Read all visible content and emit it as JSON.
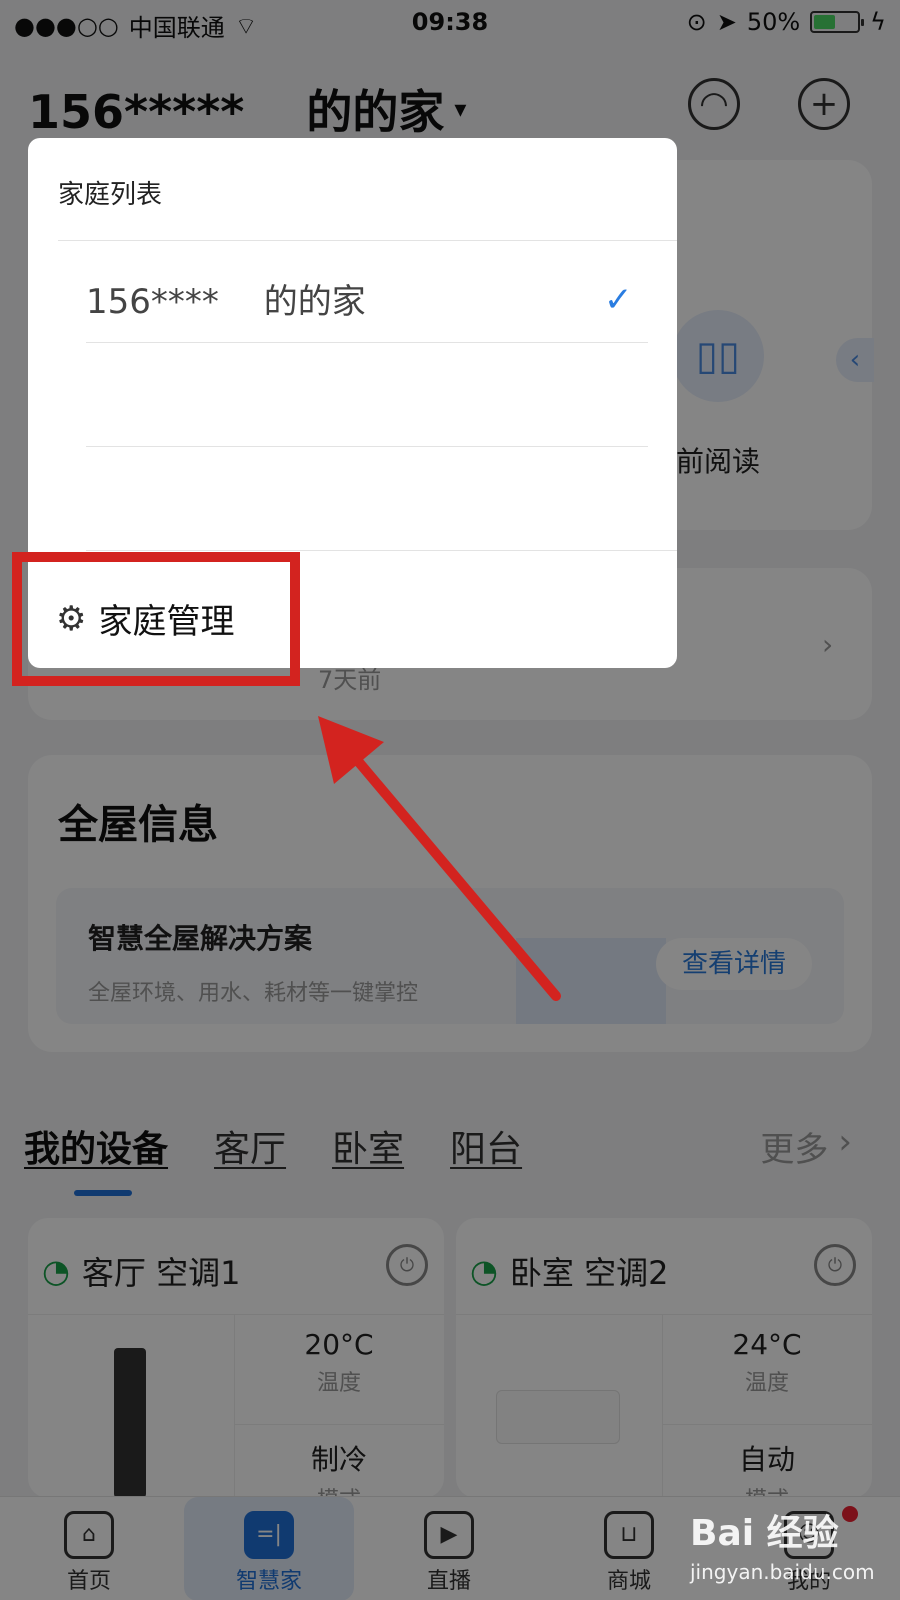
{
  "status_bar": {
    "signal": "●●●○○",
    "carrier": "中国联通",
    "time": "09:38",
    "battery": "50%"
  },
  "header": {
    "home_title": "156*****　 的的家",
    "caret": "▾"
  },
  "background": {
    "read_label": "前阅读",
    "message_time": "7天前",
    "info": {
      "title": "全屋信息",
      "solution_title": "智慧全屋解决方案",
      "solution_sub": "全屋环境、用水、耗材等一键掌控",
      "solution_button": "查看详情"
    },
    "devices_tabs": [
      "我的设备",
      "客厅",
      "卧室",
      "阳台"
    ],
    "more": "更多",
    "devices": [
      {
        "name": "客厅 空调1",
        "temp": "20°C",
        "temp_label": "温度",
        "mode": "制冷",
        "mode_label": "模式"
      },
      {
        "name": "卧室 空调2",
        "temp": "24°C",
        "temp_label": "温度",
        "mode": "自动",
        "mode_label": "模式"
      }
    ]
  },
  "bottom_nav": [
    {
      "label": "首页"
    },
    {
      "label": "智慧家"
    },
    {
      "label": "直播"
    },
    {
      "label": "商城"
    },
    {
      "label": "我的"
    }
  ],
  "popup": {
    "title": "家庭列表",
    "home_item": "156****　 的的家",
    "manage_label": "家庭管理"
  },
  "watermark": {
    "logo": "Bai 经验",
    "url": "jingyan.baidu.com"
  },
  "colors": {
    "accent": "#1f6fd6",
    "annotation": "#d3231f",
    "check": "#2a7de1"
  }
}
